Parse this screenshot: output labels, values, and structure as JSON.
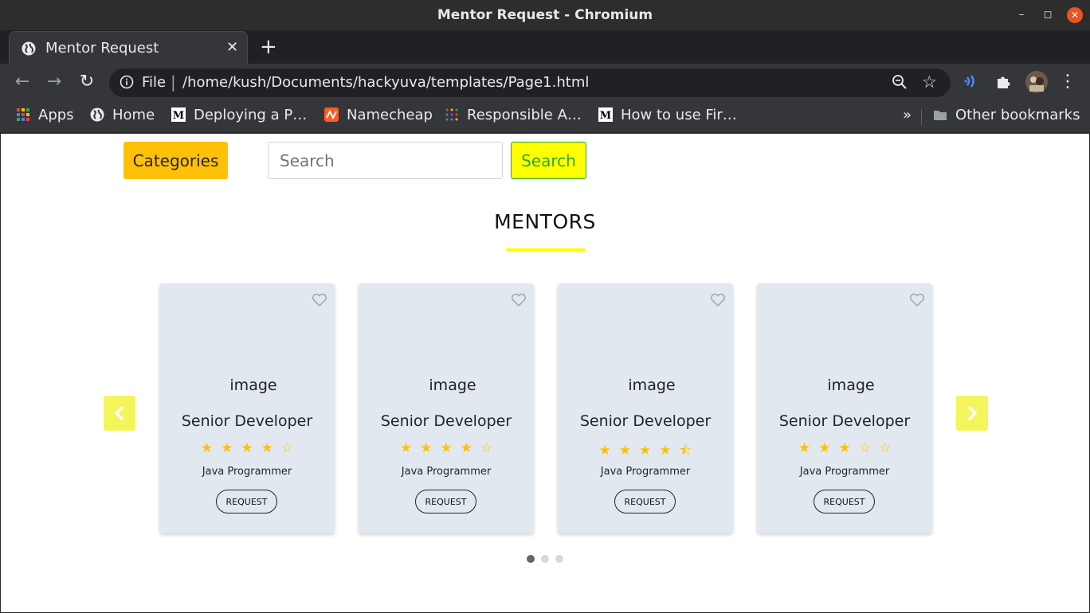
{
  "window": {
    "title": "Mentor Request - Chromium"
  },
  "tab": {
    "title": "Mentor Request"
  },
  "omnibox": {
    "scheme": "File",
    "url": "/home/kush/Documents/hackyuva/templates/Page1.html"
  },
  "bookmarks": {
    "items": [
      {
        "label": "Apps",
        "icon": "apps-grid-icon"
      },
      {
        "label": "Home",
        "icon": "globe-icon"
      },
      {
        "label": "Deploying a P…",
        "icon": "medium-icon"
      },
      {
        "label": "Namecheap",
        "icon": "namecheap-icon"
      },
      {
        "label": "Responsible A…",
        "icon": "dots-icon"
      },
      {
        "label": "How to use Fir…",
        "icon": "medium-icon"
      }
    ],
    "overflow": "»",
    "other": "Other bookmarks"
  },
  "page": {
    "categories_label": "Categories",
    "search_placeholder": "Search",
    "search_button": "Search",
    "heading": "MENTORS",
    "cards": [
      {
        "image_alt": "image",
        "role": "Senior Developer",
        "stars": "★★★★☆",
        "rating": 4,
        "skill": "Java Programmer",
        "button": "REQUEST"
      },
      {
        "image_alt": "image",
        "role": "Senior Developer",
        "stars": "★★★★☆",
        "rating": 4,
        "skill": "Java Programmer",
        "button": "REQUEST"
      },
      {
        "image_alt": "image",
        "role": "Senior Developer",
        "stars": "★★★★⯪",
        "rating": 4.5,
        "skill": "Java Programmer",
        "button": "REQUEST"
      },
      {
        "image_alt": "image",
        "role": "Senior Developer",
        "stars": "★★★☆☆",
        "rating": 3,
        "skill": "Java Programmer",
        "button": "REQUEST"
      }
    ],
    "carousel": {
      "pages": 3,
      "active_page": 1
    }
  },
  "colors": {
    "categories_bg": "#ffc107",
    "search_btn_bg": "#ffff00",
    "search_btn_text": "#28a745",
    "card_bg": "#e1e8f0",
    "star": "#ffc107",
    "arrow_bg": "#f4f55a"
  }
}
